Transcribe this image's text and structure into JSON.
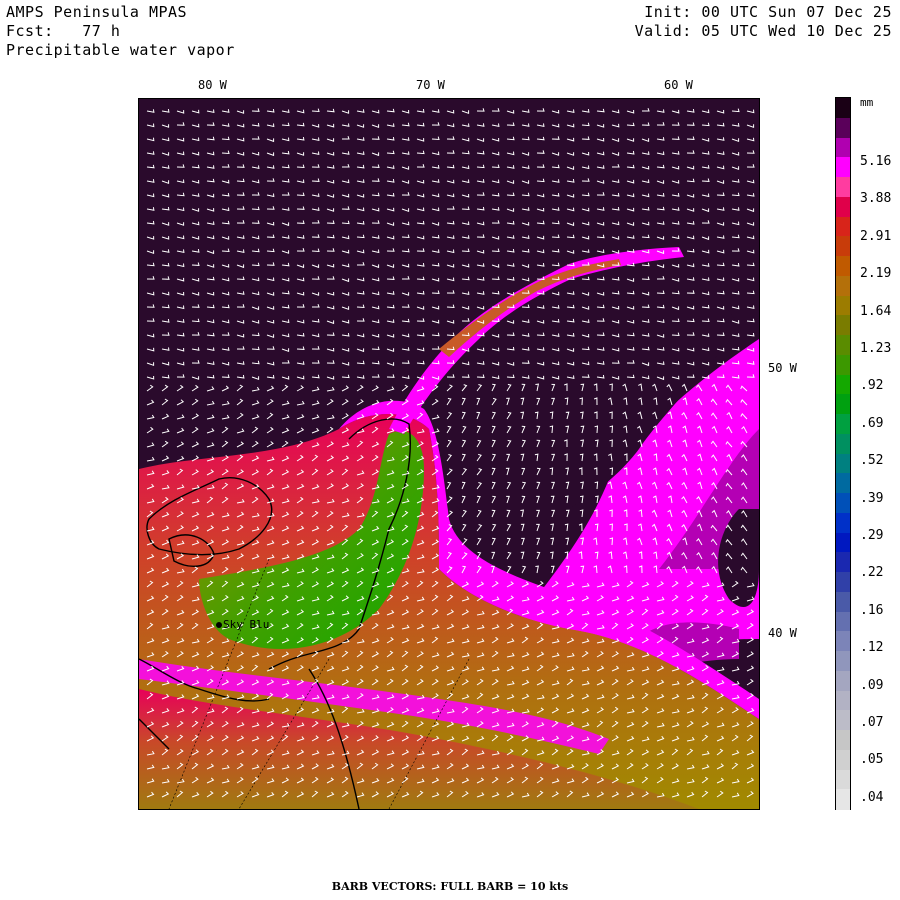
{
  "header": {
    "model": "AMPS Peninsula MPAS",
    "forecast": "Fcst:   77 h",
    "field": "Precipitable water vapor",
    "init": "Init: 00 UTC Sun 07 Dec 25",
    "valid": "Valid: 05 UTC Wed 10 Dec 25"
  },
  "axes": {
    "longitude_labels": [
      "80 W",
      "70 W",
      "60 W"
    ],
    "latitude_labels": [
      "50 W",
      "40 W"
    ]
  },
  "colorbar": {
    "unit": "mm",
    "labels": [
      "5.16",
      "3.88",
      "2.91",
      "2.19",
      "1.64",
      "1.23",
      ".92",
      ".69",
      ".52",
      ".39",
      ".29",
      ".22",
      ".16",
      ".12",
      ".09",
      ".07",
      ".05",
      ".04"
    ],
    "colors": [
      "#1a0015",
      "#5a005a",
      "#b000b0",
      "#ff00ff",
      "#ff3ca0",
      "#e0004a",
      "#d8241a",
      "#c83c0a",
      "#c05a00",
      "#b4700a",
      "#9c7c00",
      "#7a7c00",
      "#5a8c00",
      "#3c9800",
      "#14a800",
      "#00a010",
      "#00a040",
      "#009060",
      "#008080",
      "#006aa0",
      "#0050b8",
      "#0030c8",
      "#0018c0",
      "#1a28b0",
      "#3040a8",
      "#4a5aa8",
      "#6470b0",
      "#7c84b8",
      "#9096bc",
      "#a4a6c0",
      "#b2b2c4",
      "#bcbcc8",
      "#c6c6c6",
      "#d0d0d0",
      "#dadada",
      "#e6e6e6"
    ]
  },
  "map": {
    "station_name": "Sky Blu",
    "colors": {
      "dry": "#2a0a2c",
      "magenta": "#ff00ff",
      "purple": "#b400b4",
      "pink": "#e8005a",
      "orange": "#c85a28",
      "olive": "#9c8a00",
      "green": "#14a800"
    }
  },
  "footer": {
    "text": "BARB VECTORS:  FULL BARB = 10 kts"
  }
}
